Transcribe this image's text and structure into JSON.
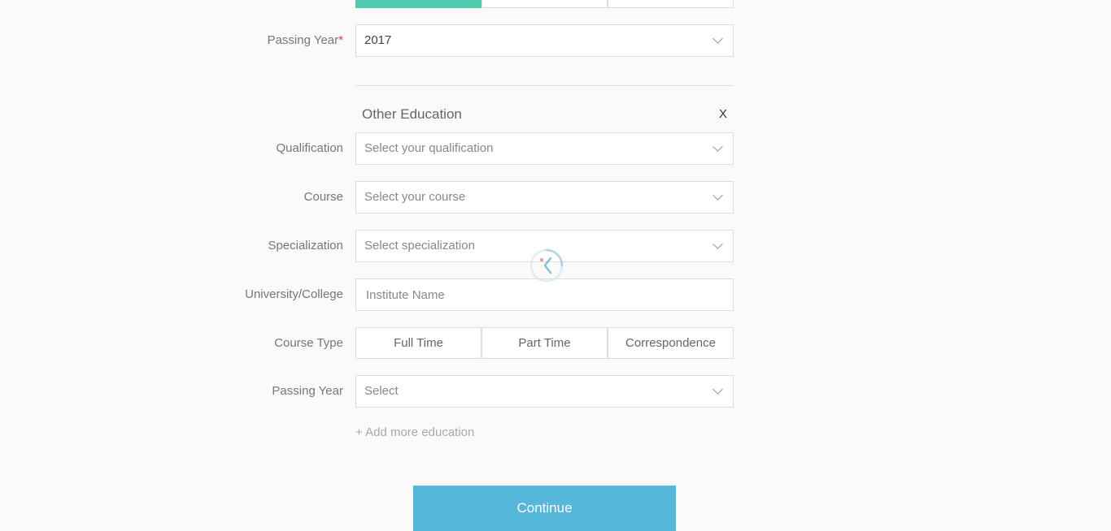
{
  "top_segment": {
    "active_index": 0
  },
  "first_education": {
    "passing_year": {
      "label": "Passing Year",
      "required_mark": "*",
      "value": "2017"
    }
  },
  "other_education": {
    "title": "Other Education",
    "close_label": "X",
    "qualification": {
      "label": "Qualification",
      "placeholder": "Select your qualification"
    },
    "course": {
      "label": "Course",
      "placeholder": "Select your course"
    },
    "specialization": {
      "label": "Specialization",
      "placeholder": "Select specialization"
    },
    "university": {
      "label": "University/College",
      "placeholder": "Institute Name"
    },
    "course_type": {
      "label": "Course Type",
      "options": [
        "Full Time",
        "Part Time",
        "Correspondence"
      ]
    },
    "passing_year": {
      "label": "Passing Year",
      "placeholder": "Select"
    }
  },
  "add_more_label": "+ Add more education",
  "continue_label": "Continue",
  "colors": {
    "accent_green": "#4ecbad",
    "button_blue": "#55b8db",
    "required_red": "#e0443c"
  },
  "icons": {
    "loading": "spinner-icon",
    "dropdown": "chevron-down-icon"
  }
}
